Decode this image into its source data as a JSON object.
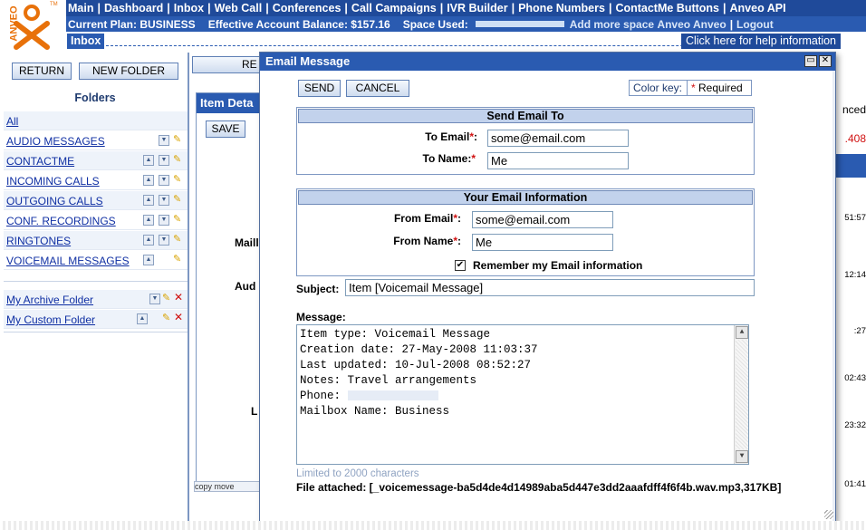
{
  "brand": {
    "logo_text": "ANVEO",
    "tm": "TM",
    "color": "#e8710a"
  },
  "topnav": {
    "items": [
      "Main",
      "Dashboard",
      "Inbox",
      "Web Call",
      "Conferences",
      "Call Campaigns",
      "IVR Builder",
      "Phone Numbers",
      "ContactMe Buttons",
      "Anveo API"
    ],
    "separator": "|"
  },
  "infobar": {
    "plan": "Current Plan: BUSINESS",
    "balance": "Effective Account Balance: $157.16",
    "space": "Space Used:",
    "add_space": "Add more space",
    "user": "Anveo Anveo",
    "logout": "Logout"
  },
  "subbar": {
    "tab": "Inbox",
    "help": "Click here for help information"
  },
  "left": {
    "return_label": "RETURN",
    "new_folder_label": "NEW FOLDER",
    "title": "Folders",
    "all": "All",
    "folders": [
      {
        "name": "AUDIO MESSAGES"
      },
      {
        "name": "CONTACTME"
      },
      {
        "name": "INCOMING CALLS"
      },
      {
        "name": "OUTGOING CALLS"
      },
      {
        "name": "CONF. RECORDINGS"
      },
      {
        "name": "RINGTONES"
      },
      {
        "name": "VOICEMAIL MESSAGES"
      }
    ],
    "custom_folders": [
      {
        "name": "My Archive Folder"
      },
      {
        "name": "My Custom Folder"
      }
    ]
  },
  "background": {
    "re_button": "RE",
    "item_panel_title": "Item Deta",
    "save_label": "SAVE",
    "labels": [
      "Maill",
      "Aud",
      "L"
    ],
    "copy_bar": "copy   move",
    "right_partial": {
      "nced": "nced",
      "num": ".408",
      "times": [
        "51:57",
        "12:14",
        ":27",
        "02:43",
        "23:32",
        "01:41"
      ]
    }
  },
  "dialog": {
    "title": "Email Message",
    "send_label": "SEND",
    "cancel_label": "CANCEL",
    "color_key": {
      "label": "Color key:",
      "star": "*",
      "required": "Required"
    },
    "send_to": {
      "heading": "Send Email To",
      "to_email_label": "To Email",
      "to_email_value": "some@email.com",
      "to_name_label": "To Name:",
      "to_name_value": "Me"
    },
    "your_info": {
      "heading": "Your Email Information",
      "from_email_label": "From Email",
      "from_email_value": "some@email.com",
      "from_name_label": "From Name",
      "from_name_value": "Me",
      "remember_label": "Remember my Email information",
      "remember_checked": true
    },
    "subject_label": "Subject:",
    "subject_value": "Item [Voicemail Message]",
    "message_label": "Message:",
    "message_lines": [
      "Item type: Voicemail Message",
      "Creation date: 27-May-2008 11:03:37",
      "Last updated: 10-Jul-2008 08:52:27",
      "Notes: Travel arrangements",
      "Phone:",
      "Mailbox Name: Business"
    ],
    "limit_note": "Limited to 2000 characters",
    "attached": "File attached: [_voicemessage-ba5d4de4d14989aba5d447e3dd2aaafdff4f6f4b.wav.mp3,317KB]"
  }
}
